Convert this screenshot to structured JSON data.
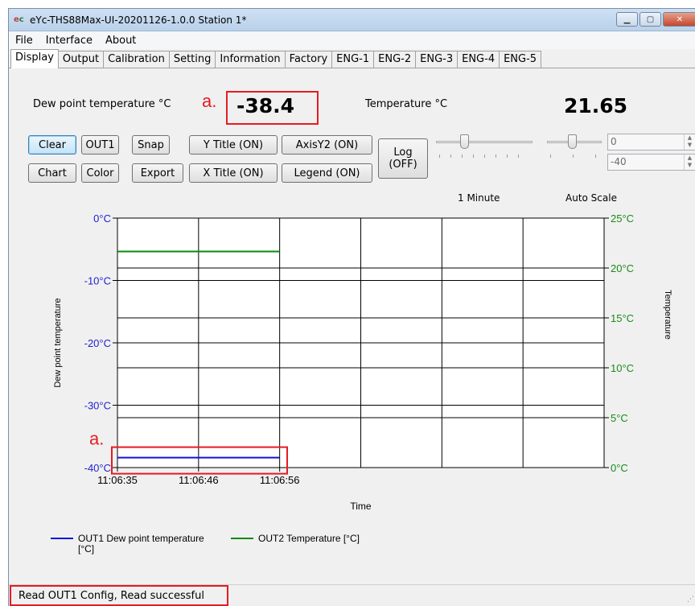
{
  "window": {
    "title": "eYc-THS88Max-UI-20201126-1.0.0  Station 1*",
    "icon": "eyc-logo-icon"
  },
  "menu": [
    "File",
    "Interface",
    "About"
  ],
  "tabs": [
    "Display",
    "Output",
    "Calibration",
    "Setting",
    "Information",
    "Factory",
    "ENG-1",
    "ENG-2",
    "ENG-3",
    "ENG-4",
    "ENG-5"
  ],
  "active_tab": "Display",
  "readouts": {
    "dew_label": "Dew point temperature  °C",
    "dew_value": "-38.4",
    "temp_label": "Temperature  °C",
    "temp_value": "21.65"
  },
  "annotations": {
    "marker": "a.",
    "color": "#e51c23"
  },
  "buttons": {
    "clear": "Clear",
    "out1": "OUT1",
    "snap": "Snap",
    "y_title": "Y Title (ON)",
    "axis_y2": "AxisY2 (ON)",
    "log_1": "Log",
    "log_2": "(OFF)",
    "chart": "Chart",
    "color": "Color",
    "export": "Export",
    "x_title": "X Title (ON)",
    "legend": "Legend (ON)"
  },
  "sliders": {
    "time_label": "1 Minute",
    "scale_label": "Auto Scale"
  },
  "spinners": {
    "max": "0",
    "min": "-40"
  },
  "chart_data": {
    "type": "line",
    "x": [
      "11:06:35",
      "11:06:46",
      "11:06:56"
    ],
    "xlabel": "Time",
    "ylabel": "Dew point temperature",
    "y2label": "Temperature",
    "ylim": [
      -40,
      0
    ],
    "y2lim": [
      0,
      25
    ],
    "yticks": [
      "0°C",
      "-10°C",
      "-20°C",
      "-30°C",
      "-40°C"
    ],
    "y2ticks": [
      "25°C",
      "20°C",
      "15°C",
      "10°C",
      "5°C",
      "0°C"
    ],
    "grid": true,
    "legend_position": "bottom-left",
    "series": [
      {
        "name": "OUT1 Dew point temperature [°C]",
        "axis": "y",
        "color": "#1010e0",
        "values": [
          -38.4,
          -38.4,
          -38.4
        ]
      },
      {
        "name": "OUT2 Temperature [°C]",
        "axis": "y2",
        "color": "#0a8a0a",
        "values": [
          21.65,
          21.65,
          21.65
        ]
      }
    ],
    "left_axis_color": "#1f1fd0",
    "right_axis_color": "#1a8a1a"
  },
  "status": {
    "text": "Read OUT1 Config,   Read successful"
  }
}
